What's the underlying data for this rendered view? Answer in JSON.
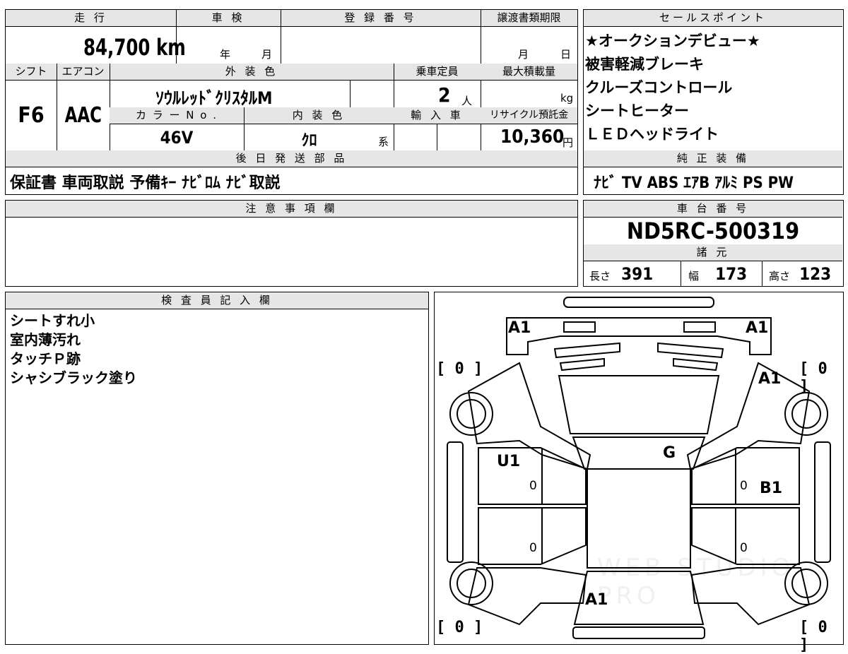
{
  "header": {
    "mileage_label": "走 行",
    "mileage_value": "84,700",
    "mileage_unit": "km",
    "inspection_label": "車 検",
    "inspection_year": "年",
    "inspection_month": "月",
    "registration_label": "登 録 番 号",
    "transfer_label": "譲渡書類期限",
    "transfer_month": "月",
    "transfer_day": "日",
    "shift_label": "シフト",
    "shift_value": "F6",
    "ac_label": "エアコン",
    "ac_value": "AAC",
    "exterior_label": "外 装 色",
    "exterior_value": "ｿｳﾙﾚｯﾄﾞｸﾘｽﾀﾙM",
    "capacity_label": "乗車定員",
    "capacity_value": "2",
    "capacity_unit": "人",
    "load_label": "最大積載量",
    "load_unit": "kg",
    "color_no_label": "カ ラ ー N o .",
    "color_no_value": "46V",
    "interior_label": "内 装 色",
    "interior_value": "ｸﾛ",
    "interior_unit": "系",
    "import_label": "輸 入 車",
    "recycle_label": "リサイクル預託金",
    "recycle_value": "10,360",
    "recycle_unit": "円",
    "later_parts_label": "後 日 発 送 部 品",
    "later_parts_value": "保証書 車両取説 予備ｷｰ ﾅﾋﾞﾛﾑ ﾅﾋﾞ取説"
  },
  "sales": {
    "label": "セールスポイント",
    "items": [
      "★オークションデビュー★",
      "被害軽減ブレーキ",
      "クルーズコントロール",
      "シートヒーター",
      "ＬＥＤヘッドライト"
    ],
    "equipment_label": "純 正 装 備",
    "equipment_value": "ﾅﾋﾞ TV ABS ｴｱB ｱﾙﾐ PS PW"
  },
  "notes": {
    "label": "注 意 事 項 欄"
  },
  "chassis": {
    "label": "車 台 番 号",
    "value": "ND5RC-500319",
    "specs_label": "諸 元",
    "length_label": "長さ",
    "length_value": "391",
    "width_label": "幅",
    "width_value": "173",
    "height_label": "高さ",
    "height_value": "123"
  },
  "inspector": {
    "label": "検 査 員 記 入 欄",
    "items": [
      "シートすれ小",
      "室内薄汚れ",
      "タッチＰ跡",
      "シャシブラック塗り"
    ]
  },
  "diagram": {
    "marks": {
      "front_left": "A1",
      "front_right": "A1",
      "right_fender": "A1",
      "windshield": "G",
      "left_door": "U1",
      "right_door": "B1",
      "rear_deck": "A1"
    },
    "tires": {
      "front_left": "[ 0 ]",
      "front_right": "[ 0 ]",
      "rear_left": "[ 0 ]",
      "rear_right": "[ 0 ]"
    },
    "zeros": [
      "0",
      "0",
      "0",
      "0"
    ],
    "watermark": "WEB STUDIO PRO"
  }
}
